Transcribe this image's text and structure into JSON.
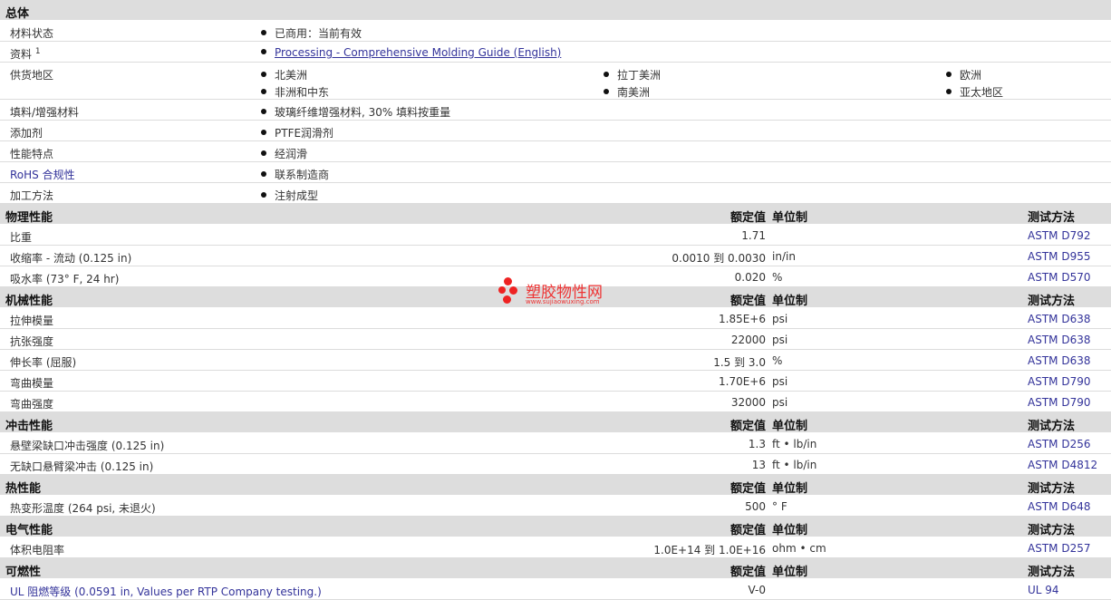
{
  "general": {
    "title": "总体",
    "rows": [
      {
        "label": "材料状态",
        "value": "已商用：当前有效"
      },
      {
        "label": "资料",
        "sup": "1",
        "value": "Processing - Comprehensive Molding Guide (English)"
      },
      {
        "label": "供货地区",
        "regions": [
          "北美洲",
          "拉丁美洲",
          "欧洲",
          "非洲和中东",
          "南美洲",
          "亚太地区"
        ]
      },
      {
        "label": "填料/增强材料",
        "value": "玻璃纤维增强材料, 30% 填料按重量"
      },
      {
        "label": "添加剂",
        "value": "PTFE润滑剂"
      },
      {
        "label": "性能特点",
        "value": "经润滑"
      },
      {
        "label": "RoHS 合规性",
        "value": "联系制造商"
      },
      {
        "label": "加工方法",
        "value": "注射成型"
      }
    ]
  },
  "headers": {
    "nominal": "额定值",
    "unit": "单位制",
    "method": "测试方法"
  },
  "sections": [
    {
      "title": "物理性能",
      "rows": [
        {
          "label": "比重",
          "value": "1.71",
          "unit": "",
          "method": "ASTM D792"
        },
        {
          "label": "收缩率 - 流动 (0.125 in)",
          "value": "0.0010 到  0.0030",
          "unit": "in/in",
          "method": "ASTM D955"
        },
        {
          "label": "吸水率 (73°  F, 24 hr)",
          "value": "0.020",
          "unit": "%",
          "method": "ASTM D570"
        }
      ]
    },
    {
      "title": "机械性能",
      "rows": [
        {
          "label": "拉伸模量",
          "value": "1.85E+6",
          "unit": "psi",
          "method": "ASTM D638"
        },
        {
          "label": "抗张强度",
          "value": "22000",
          "unit": "psi",
          "method": "ASTM D638"
        },
        {
          "label": "伸长率 (屈服)",
          "value": "1.5 到  3.0",
          "unit": "%",
          "method": "ASTM D638"
        },
        {
          "label": "弯曲模量",
          "value": "1.70E+6",
          "unit": "psi",
          "method": "ASTM D790"
        },
        {
          "label": "弯曲强度",
          "value": "32000",
          "unit": "psi",
          "method": "ASTM D790"
        }
      ]
    },
    {
      "title": "冲击性能",
      "rows": [
        {
          "label": "悬壁梁缺口冲击强度 (0.125 in)",
          "value": "1.3",
          "unit": "ft • lb/in",
          "method": "ASTM D256"
        },
        {
          "label": "无缺口悬臂梁冲击 (0.125 in)",
          "value": "13",
          "unit": "ft • lb/in",
          "method": "ASTM D4812"
        }
      ]
    },
    {
      "title": "热性能",
      "rows": [
        {
          "label": "热变形温度 (264 psi, 未退火)",
          "value": "500",
          "unit": "°  F",
          "method": "ASTM D648"
        }
      ]
    },
    {
      "title": "电气性能",
      "rows": [
        {
          "label": "体积电阻率",
          "value": "1.0E+14 到  1.0E+16",
          "unit": "ohm • cm",
          "method": "ASTM D257"
        }
      ]
    },
    {
      "title": "可燃性",
      "rows": [
        {
          "label": "UL 阻燃等级 (0.0591 in, Values per RTP Company testing.)",
          "value": "V-0",
          "unit": "",
          "method": "UL 94"
        }
      ]
    }
  ],
  "watermark": {
    "text": "塑胶物性网",
    "sub": "www.sujiaowuxing.com"
  }
}
